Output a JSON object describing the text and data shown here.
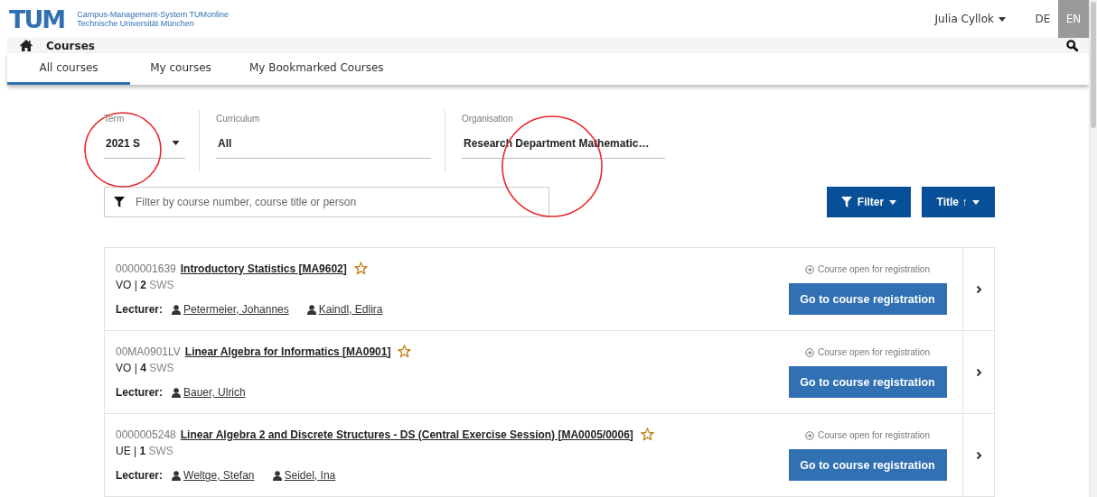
{
  "header": {
    "logo": "TUM",
    "system_name": "Campus-Management-System TUMonline",
    "university": "Technische Universität München",
    "user": "Julia Cyllok",
    "languages": [
      {
        "label": "DE",
        "selected": false
      },
      {
        "label": "EN",
        "selected": true
      }
    ]
  },
  "nav": {
    "title": "Courses"
  },
  "tabs": [
    {
      "label": "All courses",
      "selected": true
    },
    {
      "label": "My courses",
      "selected": false
    },
    {
      "label": "My Bookmarked Courses",
      "selected": false
    }
  ],
  "filters": [
    {
      "label": "Term",
      "value": "2021 S",
      "kind": "dropdown"
    },
    {
      "label": "Curriculum",
      "value": "All",
      "kind": "text"
    },
    {
      "label": "Organisation",
      "value": "Research Department Mathematic…",
      "kind": "text"
    }
  ],
  "search": {
    "placeholder": "Filter by course number, course title or person"
  },
  "buttons": [
    {
      "label": "Filter",
      "kind": "filter"
    },
    {
      "label": "Title ↑",
      "kind": "sort"
    }
  ],
  "courses": [
    {
      "number": "0000001639",
      "title": "Introductory Statistics [MA9602]",
      "bookmarked": false,
      "type": "VO | **2**",
      "unit": "SWS",
      "lecturer_label": "Lecturer:",
      "lecturers": [
        "Petermeier, Johannes",
        "Kaindl, Edlira"
      ],
      "status": "Course open for registration",
      "action": "Go to course registration"
    },
    {
      "number": "00MA0901LV",
      "title": "Linear Algebra for Informatics [MA0901]",
      "bookmarked": false,
      "type": "VO | **4**",
      "unit": "SWS",
      "lecturer_label": "Lecturer:",
      "lecturers": [
        "Bauer, Ulrich"
      ],
      "status": "Course open for registration",
      "action": "Go to course registration"
    },
    {
      "number": "0000005248",
      "title": "Linear Algebra 2 and Discrete Structures - DS (Central Exercise Session) [MA0005/0006]",
      "bookmarked": false,
      "type": "UE | **1**",
      "unit": "SWS",
      "lecturer_label": "Lecturer:",
      "lecturers": [
        "Weltge, Stefan",
        "Seidel, Ina"
      ],
      "status": "Course open for registration",
      "action": "Go to course registration"
    }
  ],
  "annotations": [
    {
      "kind": "circle"
    },
    {
      "kind": "circle"
    }
  ]
}
